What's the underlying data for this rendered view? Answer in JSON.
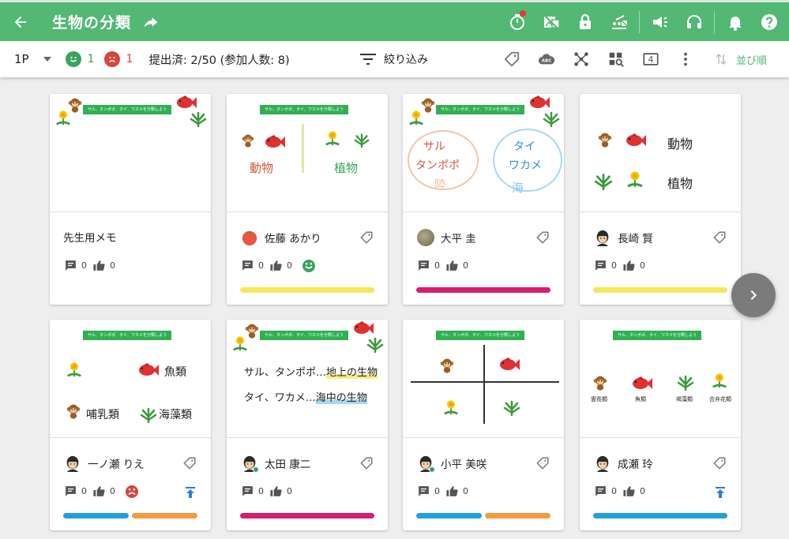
{
  "header": {
    "title": "生物の分類"
  },
  "toolbar": {
    "page": "1P",
    "positive_count": "1",
    "negative_count": "1",
    "submitted": "提出済: 2/50 (参加人数: 8)",
    "filter_label": "絞り込み",
    "page_number": "4",
    "sort_label": "並び順"
  },
  "assignment_banner": "サル、タンポポ、タイ、ワカメを分類しよう",
  "cards": [
    {
      "name": "先生用メモ",
      "comments": "0",
      "likes": "0",
      "bars": []
    },
    {
      "name": "佐藤 あかり",
      "comments": "0",
      "likes": "0",
      "bars": [
        "#f6e65b"
      ],
      "labels": {
        "animal": "動物",
        "plant": "植物"
      }
    },
    {
      "name": "大平 圭",
      "comments": "0",
      "likes": "0",
      "bars": [
        "#d81b73"
      ],
      "labels": {
        "left1": "サル",
        "left2": "タンポポ",
        "left3": "陸",
        "right1": "タイ",
        "right2": "ワカメ",
        "right3": "海"
      }
    },
    {
      "name": "長崎 賢",
      "comments": "0",
      "likes": "0",
      "bars": [
        "#f6e65b"
      ],
      "labels": {
        "animal": "動物",
        "plant": "植物"
      }
    },
    {
      "name": "一ノ瀬 りえ",
      "comments": "0",
      "likes": "0",
      "bars": [
        "#22a0d8",
        "#f59a3c"
      ],
      "labels": {
        "fish": "魚類",
        "mammal": "哺乳類",
        "seaweed": "海藻類"
      }
    },
    {
      "name": "太田 康二",
      "comments": "0",
      "likes": "0",
      "bars": [
        "#d81b73"
      ],
      "labels": {
        "line1a": "サル、タンポポ…",
        "line1b": "地上の生物",
        "line2a": "タイ、ワカメ…",
        "line2b": "海中の生物"
      }
    },
    {
      "name": "小平 美咲",
      "comments": "0",
      "likes": "0",
      "bars": [
        "#22a0d8",
        "#f59a3c"
      ]
    },
    {
      "name": "成瀬 玲",
      "comments": "0",
      "likes": "0",
      "bars": [
        "#22a0d8"
      ],
      "labels": {
        "a": "霊長類",
        "b": "魚類",
        "c": "褐藻類",
        "d": "合弁花類"
      }
    }
  ],
  "colors": {
    "brand": "#52b874",
    "positive": "#3aa35d",
    "negative": "#d6453c"
  }
}
